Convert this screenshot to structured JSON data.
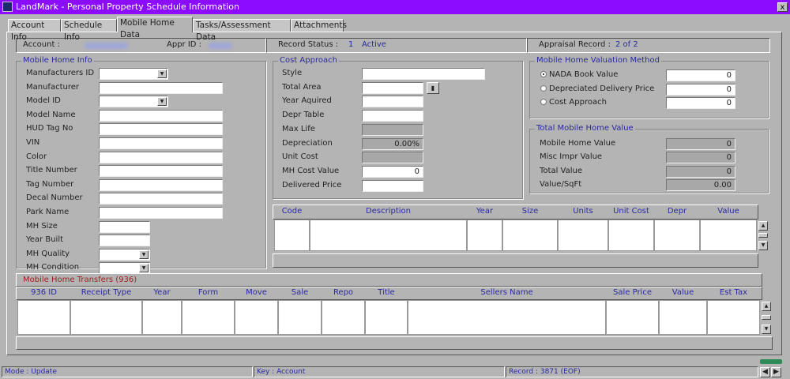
{
  "window": {
    "title": "LandMark - Personal Property Schedule Information",
    "close": "x"
  },
  "tabs": [
    {
      "label": "Account Info"
    },
    {
      "label": "Schedule Info"
    },
    {
      "label": "Mobile Home Data",
      "active": true
    },
    {
      "label": "Tasks/Assessment Data"
    },
    {
      "label": "Attachments"
    }
  ],
  "header": {
    "account_label": "Account :",
    "appr_id_label": "Appr ID :",
    "record_status_label": "Record Status :",
    "record_status_code": "1",
    "record_status_text": "Active",
    "appraisal_record_label": "Appraisal Record :",
    "appraisal_record_value": "2 of 2"
  },
  "mobile_home_info": {
    "title": "Mobile Home Info",
    "fields": [
      {
        "label": "Manufacturers ID",
        "type": "dropdown"
      },
      {
        "label": "Manufacturer",
        "type": "text"
      },
      {
        "label": "Model ID",
        "type": "dropdown"
      },
      {
        "label": "Model Name",
        "type": "text"
      },
      {
        "label": "HUD Tag No",
        "type": "text"
      },
      {
        "label": "VIN",
        "type": "text"
      },
      {
        "label": "Color",
        "type": "text"
      },
      {
        "label": "Title Number",
        "type": "text"
      },
      {
        "label": "Tag Number",
        "type": "text"
      },
      {
        "label": "Decal Number",
        "type": "text"
      },
      {
        "label": "Park Name",
        "type": "text"
      },
      {
        "label": "MH Size",
        "type": "short"
      },
      {
        "label": "Year Built",
        "type": "short"
      },
      {
        "label": "MH Quality",
        "type": "shortdd"
      },
      {
        "label": "MH Condition",
        "type": "shortdd"
      }
    ]
  },
  "cost_approach": {
    "title": "Cost Approach",
    "fields": [
      {
        "label": "Style",
        "type": "widedd",
        "value": ""
      },
      {
        "label": "Total Area",
        "type": "btn",
        "value": ""
      },
      {
        "label": "Year Aquired",
        "type": "text",
        "value": ""
      },
      {
        "label": "Depr Table",
        "type": "dropdown",
        "value": ""
      },
      {
        "label": "Max Life",
        "type": "gray",
        "value": ""
      },
      {
        "label": "Depreciation",
        "type": "gray",
        "value": "0.00%"
      },
      {
        "label": "Unit Cost",
        "type": "gray",
        "value": ""
      },
      {
        "label": "MH Cost Value",
        "type": "text",
        "value": "0"
      },
      {
        "label": "Delivered Price",
        "type": "text",
        "value": ""
      }
    ]
  },
  "valuation_method": {
    "title": "Mobile Home Valuation Method",
    "options": [
      {
        "label": "NADA Book Value",
        "selected": true,
        "value": "0"
      },
      {
        "label": "Depreciated Delivery Price",
        "selected": false,
        "value": "0"
      },
      {
        "label": "Cost Approach",
        "selected": false,
        "value": "0"
      }
    ]
  },
  "total_value": {
    "title": "Total Mobile Home Value",
    "rows": [
      {
        "label": "Mobile Home Value",
        "value": "0"
      },
      {
        "label": "Misc Impr Value",
        "value": "0"
      },
      {
        "label": "Total Value",
        "value": "0"
      },
      {
        "label": "Value/SqFt",
        "value": "0.00"
      }
    ]
  },
  "misc_grid": {
    "columns": [
      "Code",
      "Description",
      "Year",
      "Size",
      "Units",
      "Unit Cost",
      "Depr",
      "Value"
    ]
  },
  "transfers": {
    "title": "Mobile Home Transfers (936)",
    "title_color": "#a02020",
    "columns": [
      "936 ID",
      "Receipt Type",
      "Year",
      "Form",
      "Move",
      "Sale",
      "Repo",
      "Title",
      "Sellers Name",
      "Sale Price",
      "Value",
      "Est Tax"
    ]
  },
  "statusbar": {
    "mode": "Mode : Update",
    "key": "Key : Account",
    "record": "Record : 3871 (EOF)"
  },
  "colors": {
    "titlebar": "#8c0cff",
    "accent_text": "#2a2aa0",
    "indicator": "#2e8b57"
  }
}
